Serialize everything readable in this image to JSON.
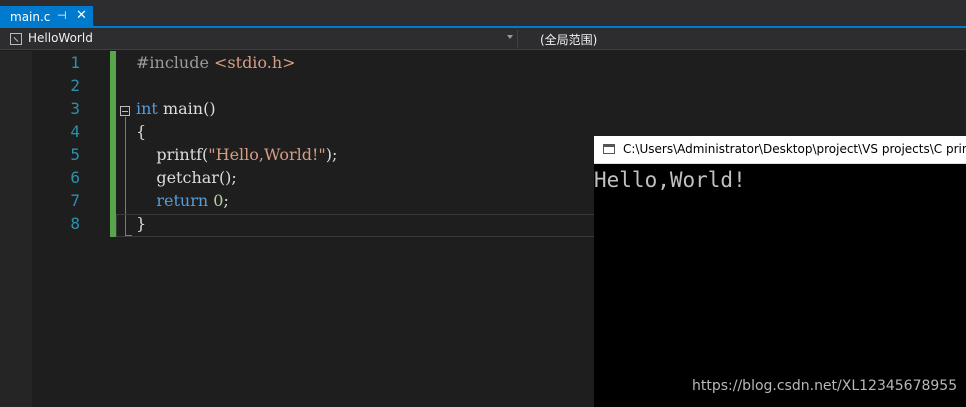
{
  "tab": {
    "label": "main.c",
    "pin_glyph": "⊣",
    "close_glyph": "✕"
  },
  "navbar": {
    "project": "HelloWorld",
    "scope": "(全局范围)"
  },
  "editor": {
    "line_numbers": [
      "1",
      "2",
      "3",
      "4",
      "5",
      "6",
      "7",
      "8"
    ],
    "lines": [
      [
        {
          "t": "#include ",
          "c": "#9b9b9b"
        },
        {
          "t": "<stdio.h>",
          "c": "#d69d85"
        }
      ],
      [],
      [
        {
          "t": "int",
          "c": "#569cd6"
        },
        {
          "t": " main()",
          "c": "#dcdcdc"
        }
      ],
      [
        {
          "t": "{",
          "c": "#dcdcdc"
        }
      ],
      [
        {
          "t": "    printf(",
          "c": "#dcdcdc"
        },
        {
          "t": "\"Hello,World!\"",
          "c": "#d69d85"
        },
        {
          "t": ");",
          "c": "#dcdcdc"
        }
      ],
      [
        {
          "t": "    getchar();",
          "c": "#dcdcdc"
        }
      ],
      [
        {
          "t": "    ",
          "c": "#dcdcdc"
        },
        {
          "t": "return",
          "c": "#569cd6"
        },
        {
          "t": " ",
          "c": "#dcdcdc"
        },
        {
          "t": "0",
          "c": "#b5cea8"
        },
        {
          "t": ";",
          "c": "#dcdcdc"
        }
      ],
      [
        {
          "t": "}",
          "c": "#dcdcdc"
        }
      ]
    ]
  },
  "console": {
    "title": "C:\\Users\\Administrator\\Desktop\\project\\VS projects\\C prin",
    "output": "Hello,World!"
  },
  "watermark": "https://blog.csdn.net/XL12345678955"
}
